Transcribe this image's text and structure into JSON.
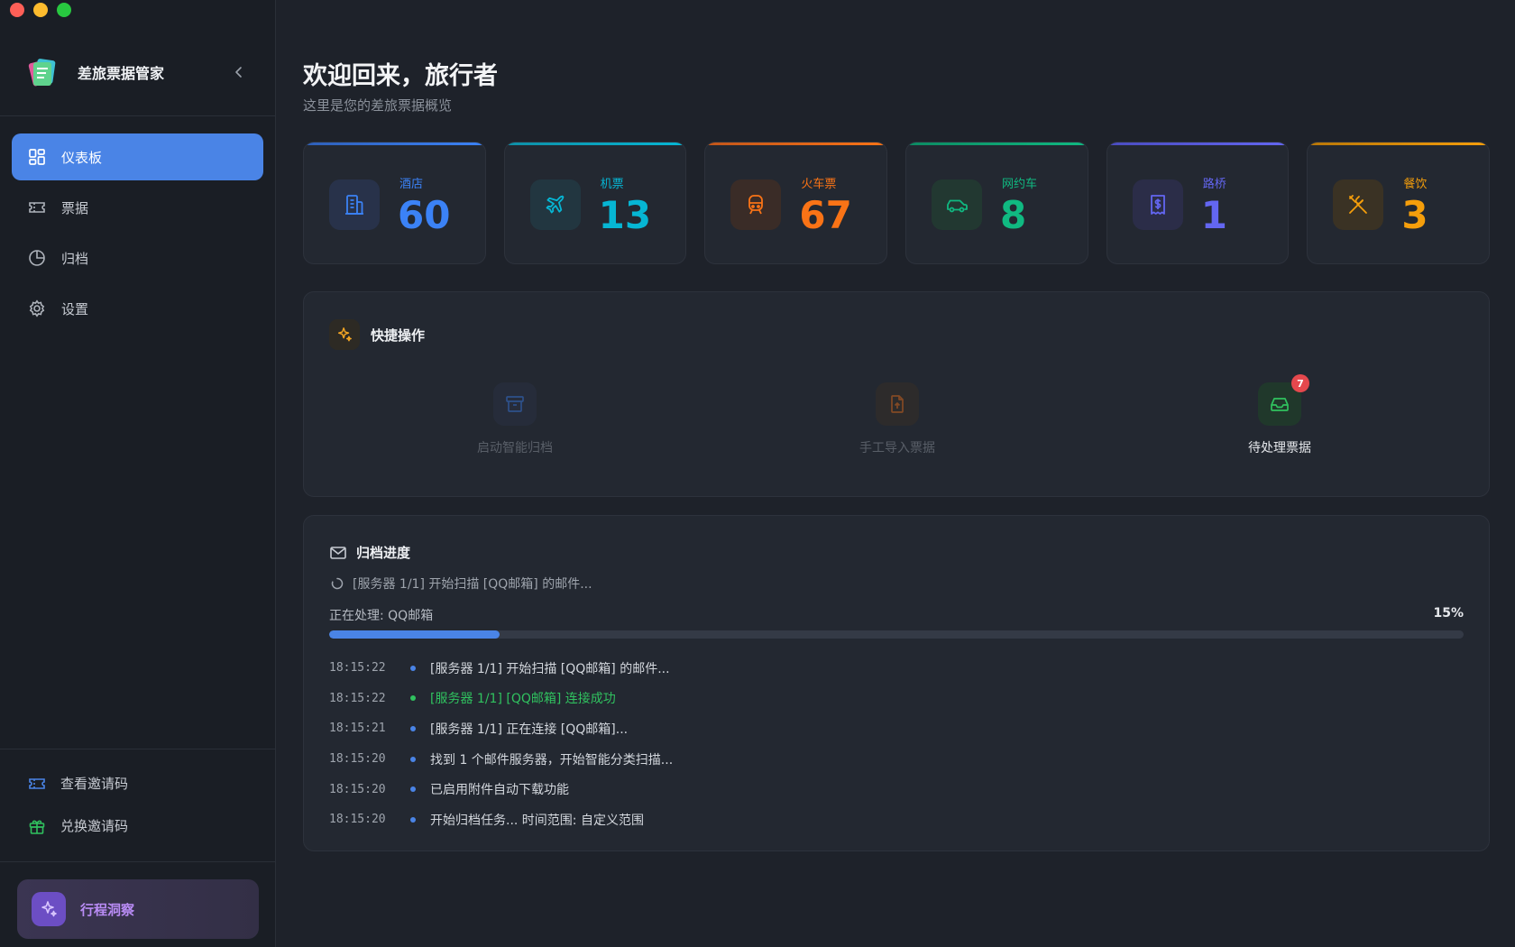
{
  "app": {
    "title": "差旅票据管家"
  },
  "sidebar": {
    "nav": [
      {
        "label": "仪表板",
        "icon": "dashboard-icon",
        "active": true
      },
      {
        "label": "票据",
        "icon": "ticket-icon",
        "active": false
      },
      {
        "label": "归档",
        "icon": "pie-chart-icon",
        "active": false
      },
      {
        "label": "设置",
        "icon": "gear-icon",
        "active": false
      }
    ],
    "bottom": [
      {
        "label": "查看邀请码",
        "icon": "ticket-icon"
      },
      {
        "label": "兑换邀请码",
        "icon": "gift-icon"
      }
    ],
    "insight_label": "行程洞察"
  },
  "header": {
    "title": "欢迎回来，旅行者",
    "subtitle": "这里是您的差旅票据概览"
  },
  "stats": [
    {
      "label": "酒店",
      "value": "60",
      "color": "#3b82f6",
      "icon": "building-icon"
    },
    {
      "label": "机票",
      "value": "13",
      "color": "#06b6d4",
      "icon": "plane-icon"
    },
    {
      "label": "火车票",
      "value": "67",
      "color": "#f97316",
      "icon": "train-icon"
    },
    {
      "label": "网约车",
      "value": "8",
      "color": "#10b981",
      "icon": "car-icon"
    },
    {
      "label": "路桥",
      "value": "1",
      "color": "#6366f1",
      "icon": "receipt-icon"
    },
    {
      "label": "餐饮",
      "value": "3",
      "color": "#f59e0b",
      "icon": "utensils-icon"
    }
  ],
  "quick_actions": {
    "title": "快捷操作",
    "items": [
      {
        "label": "启动智能归档",
        "icon": "archive-icon",
        "enabled": false
      },
      {
        "label": "手工导入票据",
        "icon": "file-upload-icon",
        "enabled": false
      },
      {
        "label": "待处理票据",
        "icon": "inbox-icon",
        "enabled": true,
        "badge": "7"
      }
    ]
  },
  "archive_progress": {
    "title": "归档进度",
    "status": "[服务器 1/1] 开始扫描 [QQ邮箱] 的邮件...",
    "processing": "正在处理: QQ邮箱",
    "percent_label": "15%",
    "percent": 15,
    "log": [
      {
        "time": "18:15:22",
        "message": "[服务器 1/1] 开始扫描 [QQ邮箱] 的邮件...",
        "type": "info"
      },
      {
        "time": "18:15:22",
        "message": "[服务器 1/1] [QQ邮箱] 连接成功",
        "type": "success"
      },
      {
        "time": "18:15:21",
        "message": "[服务器 1/1] 正在连接 [QQ邮箱]...",
        "type": "info"
      },
      {
        "time": "18:15:20",
        "message": "找到 1 个邮件服务器，开始智能分类扫描...",
        "type": "info"
      },
      {
        "time": "18:15:20",
        "message": "已启用附件自动下载功能",
        "type": "info"
      },
      {
        "time": "18:15:20",
        "message": "开始归档任务... 时间范围: 自定义范围",
        "type": "info"
      }
    ]
  }
}
